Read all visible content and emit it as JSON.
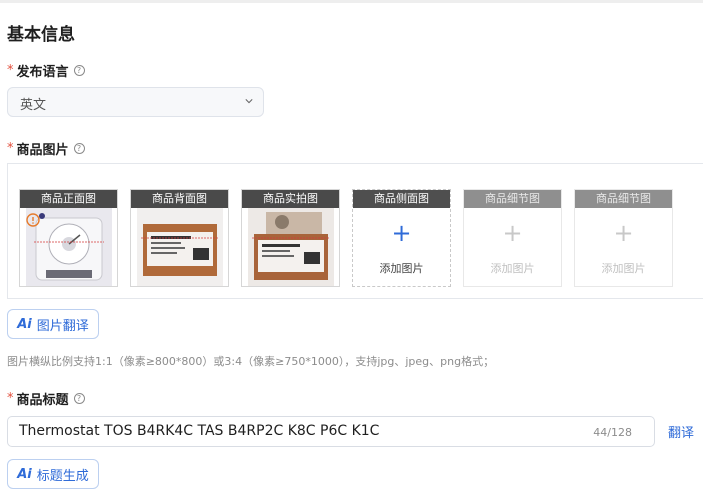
{
  "section_title": "基本信息",
  "required_mark": "*",
  "language": {
    "label": "发布语言",
    "value": "英文"
  },
  "images": {
    "label": "商品图片",
    "slots": [
      {
        "caption": "商品正面图",
        "state": "filled"
      },
      {
        "caption": "商品背面图",
        "state": "filled"
      },
      {
        "caption": "商品实拍图",
        "state": "filled"
      },
      {
        "caption": "商品侧面图",
        "state": "empty",
        "add_label": "添加图片"
      },
      {
        "caption": "商品细节图",
        "state": "disabled",
        "add_label": "添加图片"
      },
      {
        "caption": "商品细节图",
        "state": "disabled",
        "add_label": "添加图片"
      }
    ],
    "translate_button": "图片翻译",
    "hint": "图片横纵比例支持1:1（像素≥800*800）或3:4（像素≥750*1000），支持jpg、jpeg、png格式；"
  },
  "title": {
    "label": "商品标题",
    "value": "Thermostat TOS B4RK4C TAS B4RP2C K8C P6C K1C",
    "counter": "44/128",
    "translate_link": "翻译",
    "generate_button": "标题生成"
  },
  "ai_badge": "Ai",
  "plus_glyph": "+",
  "help_glyph": "?",
  "colors": {
    "accent": "#2f6bd8",
    "required": "#e34d3b",
    "hint": "#8c8c8c"
  }
}
